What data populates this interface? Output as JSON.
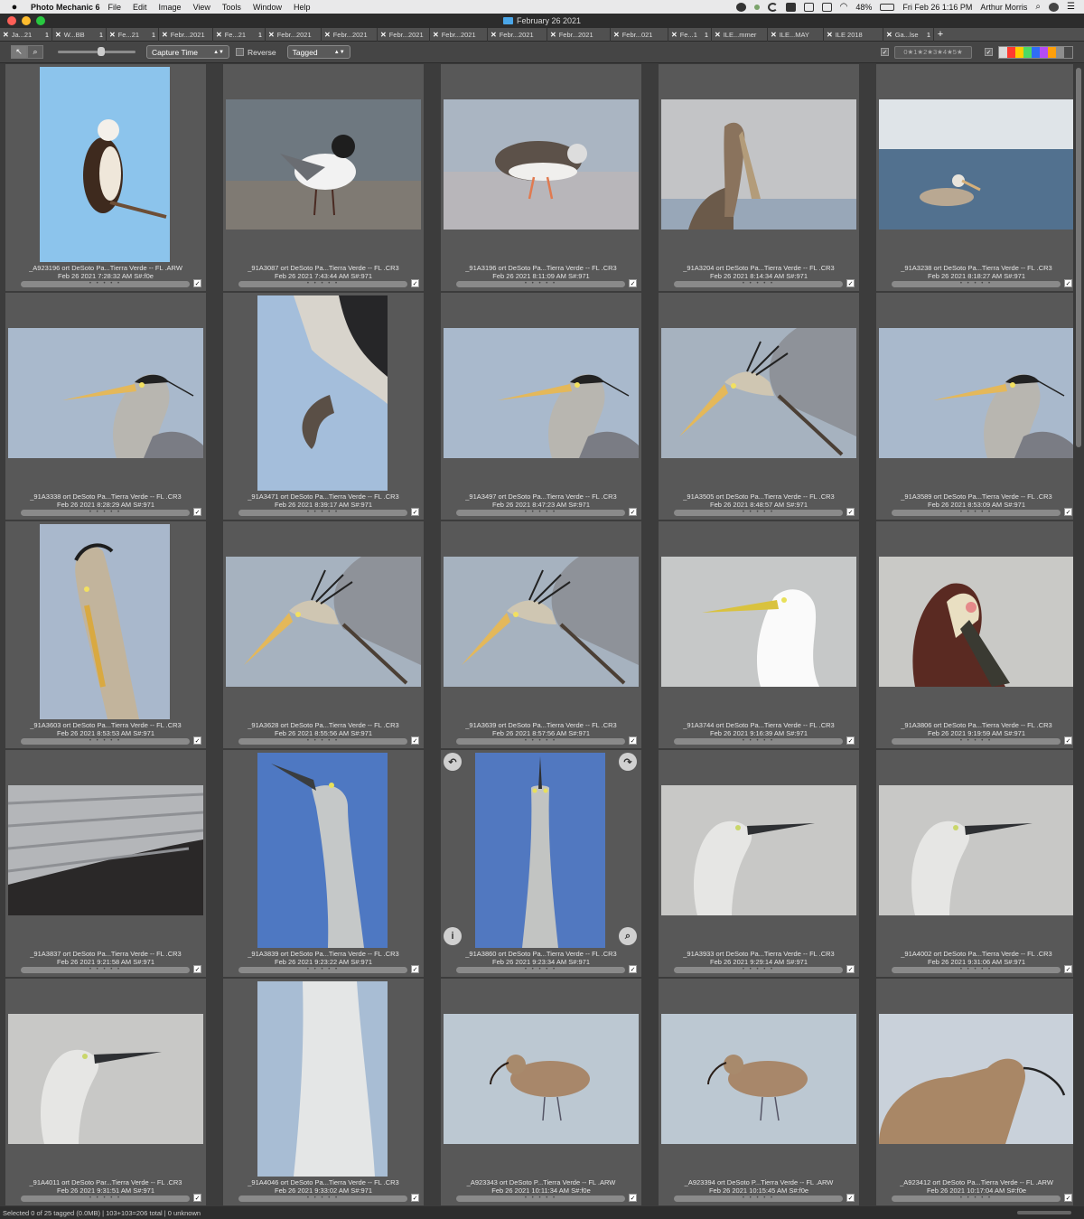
{
  "menubar": {
    "apple": "",
    "app_name": "Photo Mechanic 6",
    "menus": [
      "File",
      "Edit",
      "Image",
      "View",
      "Tools",
      "Window",
      "Help"
    ],
    "battery": "48%",
    "datetime": "Fri Feb 26  1:16 PM",
    "user": "Arthur Morris"
  },
  "window": {
    "title": "February 26 2021"
  },
  "tabs": [
    {
      "label": "Ja...21",
      "count": "1"
    },
    {
      "label": "W...BB",
      "count": "1"
    },
    {
      "label": "Fe...21",
      "count": "1"
    },
    {
      "label": "Febr...2021",
      "count": ""
    },
    {
      "label": "Fe...21",
      "count": "1"
    },
    {
      "label": "Febr...2021",
      "count": ""
    },
    {
      "label": "Febr...2021",
      "count": ""
    },
    {
      "label": "Febr...2021",
      "count": ""
    },
    {
      "label": "Febr...2021",
      "count": ""
    },
    {
      "label": "Febr...2021",
      "count": ""
    },
    {
      "label": "Febr...2021",
      "count": ""
    },
    {
      "label": "Febr...021",
      "count": ""
    },
    {
      "label": "Fe...1",
      "count": "1"
    },
    {
      "label": "ILE...mmer",
      "count": ""
    },
    {
      "label": "ILE...MAY",
      "count": ""
    },
    {
      "label": "ILE 2018",
      "count": ""
    },
    {
      "label": "Ga...lse",
      "count": "1"
    }
  ],
  "toolbar": {
    "sort": "Capture Time",
    "reverse_label": "Reverse",
    "filter": "Tagged",
    "stars_label": "0★1★2★3★4★5★",
    "color_classes": [
      "#d9d9d9",
      "#ff3b30",
      "#ffcc00",
      "#4cd964",
      "#2f6df6",
      "#b44cf5",
      "#ff9f0a",
      "#8e8e8e",
      "#4a4a4a"
    ]
  },
  "thumbs": [
    {
      "name": "_A923196 ort DeSoto Pa...Tierra Verde  -- FL .ARW",
      "date": "Feb 26 2021 7:28:32 AM S#:f0e",
      "subject": "osprey"
    },
    {
      "name": "_91A3087 ort DeSoto Pa...Tierra Verde  -- FL .CR3",
      "date": "Feb 26 2021 7:43:44 AM S#:971",
      "subject": "laughing-gull"
    },
    {
      "name": "_91A3196 ort DeSoto Pa...Tierra Verde  -- FL .CR3",
      "date": "Feb 26 2021 8:11:09 AM S#:971",
      "subject": "ruddy-turnstone"
    },
    {
      "name": "_91A3204 ort DeSoto Pa...Tierra Verde  -- FL .CR3",
      "date": "Feb 26 2021 8:14:34 AM S#:971",
      "subject": "brown-pelican"
    },
    {
      "name": "_91A3238 ort DeSoto Pa...Tierra Verde  -- FL .CR3",
      "date": "Feb 26 2021 8:18:27 AM S#:971",
      "subject": "pelican-swimming"
    },
    {
      "name": "_91A3338 ort DeSoto Pa...Tierra Verde  -- FL .CR3",
      "date": "Feb 26 2021 8:28:29 AM S#:971",
      "subject": "heron-head"
    },
    {
      "name": "_91A3471 ort DeSoto Pa...Tierra Verde  -- FL .CR3",
      "date": "Feb 26 2021 8:39:17 AM S#:971",
      "subject": "heron-foot"
    },
    {
      "name": "_91A3497 ort DeSoto Pa...Tierra Verde  -- FL .CR3",
      "date": "Feb 26 2021 8:47:23 AM S#:971",
      "subject": "heron-head"
    },
    {
      "name": "_91A3505 ort DeSoto Pa...Tierra Verde  -- FL .CR3",
      "date": "Feb 26 2021 8:48:57 AM S#:971",
      "subject": "heron-scratch"
    },
    {
      "name": "_91A3589 ort DeSoto Pa...Tierra Verde  -- FL .CR3",
      "date": "Feb 26 2021 8:53:09 AM S#:971",
      "subject": "heron-head"
    },
    {
      "name": "_91A3603 ort DeSoto Pa...Tierra Verde  -- FL .CR3",
      "date": "Feb 26 2021 8:53:53 AM S#:971",
      "subject": "heron-neck"
    },
    {
      "name": "_91A3628 ort DeSoto Pa...Tierra Verde  -- FL .CR3",
      "date": "Feb 26 2021 8:55:56 AM S#:971",
      "subject": "heron-scratch"
    },
    {
      "name": "_91A3639 ort DeSoto Pa...Tierra Verde  -- FL .CR3",
      "date": "Feb 26 2021 8:57:56 AM S#:971",
      "subject": "heron-scratch"
    },
    {
      "name": "_91A3744 ort DeSoto Pa...Tierra Verde  -- FL .CR3",
      "date": "Feb 26 2021 9:16:39 AM S#:971",
      "subject": "great-egret"
    },
    {
      "name": "_91A3806 ort DeSoto Pa...Tierra Verde  -- FL .CR3",
      "date": "Feb 26 2021 9:19:59 AM S#:971",
      "subject": "pelican-head"
    },
    {
      "name": "_91A3837 ort DeSoto Pa...Tierra Verde  -- FL .CR3",
      "date": "Feb 26 2021 9:21:58 AM S#:971",
      "subject": "feathers"
    },
    {
      "name": "_91A3839 ort DeSoto Pa...Tierra Verde  -- FL .CR3",
      "date": "Feb 26 2021 9:23:22 AM S#:971",
      "subject": "juvenile-heron"
    },
    {
      "name": "_91A3860 ort DeSoto Pa...Tierra Verde  -- FL .CR3",
      "date": "Feb 26 2021 9:23:34 AM S#:971",
      "subject": "heron-up"
    },
    {
      "name": "_91A3933 ort DeSoto Pa...Tierra Verde  -- FL .CR3",
      "date": "Feb 26 2021 9:29:14 AM S#:971",
      "subject": "white-heron"
    },
    {
      "name": "_91A4002 ort DeSoto Pa...Tierra Verde  -- FL .CR3",
      "date": "Feb 26 2021 9:31:06 AM S#:971",
      "subject": "white-heron"
    },
    {
      "name": "_91A4011 ort DeSoto Par...Tierra Verde  -- FL .CR3",
      "date": "Feb 26 2021 9:31:51 AM S#:971",
      "subject": "white-heron"
    },
    {
      "name": "_91A4046 ort DeSoto Pa...Tierra Verde  -- FL .CR3",
      "date": "Feb 26 2021 9:33:02 AM S#:971",
      "subject": "white-neck"
    },
    {
      "name": "_A923343 ort DeSoto P...Tierra Verde  -- FL .ARW",
      "date": "Feb 26 2021 10:11:34 AM S#:f0e",
      "subject": "whimbrel"
    },
    {
      "name": "_A923394 ort DeSoto P...Tierra Verde  -- FL .ARW",
      "date": "Feb 26 2021 10:15:45 AM S#:f0e",
      "subject": "whimbrel"
    },
    {
      "name": "_A923412 ort DeSoto Pa...Tierra Verde  -- FL .ARW",
      "date": "Feb 26 2021 10:17:04 AM S#:f0e",
      "subject": "whimbrel-close"
    }
  ],
  "rating_dots": "• • • • •",
  "tag_mark": "✓",
  "overlay": {
    "rotate_left": "↶",
    "rotate_right": "↷",
    "info": "i",
    "zoom": "⌕"
  },
  "status": "Selected 0 of 25 tagged (0.0MB) | 103+103=206 total | 0 unknown"
}
